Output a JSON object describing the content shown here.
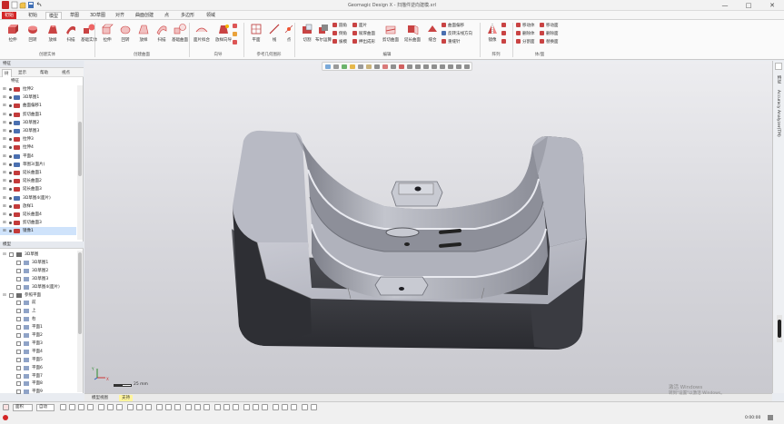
{
  "window": {
    "title": "Geomagic Design X - 扫描件逆向建模.xrl",
    "minimize": "—",
    "maximize": "□",
    "close": "✕"
  },
  "menu": {
    "tabs": [
      "初始",
      "初始",
      "模型",
      "草图",
      "3D草图",
      "对齐",
      "曲面创建",
      "点",
      "多边形",
      "领域"
    ]
  },
  "ribbon": {
    "create_solid": {
      "label": "创建实体",
      "buttons": [
        "拉伸",
        "回转",
        "放样",
        "扫描",
        "基础实体"
      ]
    },
    "create_surface": {
      "label": "创建曲面",
      "buttons": [
        "拉伸",
        "回转",
        "放样",
        "扫描",
        "基础曲面"
      ]
    },
    "wizard": {
      "label": "向导",
      "buttons": [
        "面片拟合",
        "放样向导"
      ]
    },
    "ref_geometry": {
      "label": "参考几何图形",
      "buttons": [
        "平面",
        "线",
        "点"
      ]
    },
    "edit": {
      "label": "编辑",
      "big_buttons": [
        "切割",
        "布尔运算",
        "剪切曲面",
        "延长曲面",
        "缝合"
      ],
      "small_items": [
        "圆角",
        "倒角",
        "拔模",
        "面片",
        "赋厚曲面",
        "押出成形",
        "曲面偏移",
        "反转法线方向",
        "重缝针"
      ]
    },
    "array": {
      "label": "阵列",
      "buttons": [
        "镜像"
      ]
    },
    "body_face": {
      "label": "体/面",
      "items": [
        "移动体",
        "删除体",
        "分割面",
        "移动面",
        "删除面",
        "替换面"
      ]
    }
  },
  "left_panel": {
    "header": "特征",
    "tabs": [
      "树",
      "显示",
      "帮助",
      "视点"
    ],
    "feature_header": "特征",
    "feature_tree": [
      {
        "label": "拉伸2",
        "color": "#c33a3a"
      },
      {
        "label": "3D草图1",
        "color": "#4a6fb0"
      },
      {
        "label": "曲面偏移1",
        "color": "#c33a3a"
      },
      {
        "label": "剪切曲面1",
        "color": "#c33a3a"
      },
      {
        "label": "3D草图2",
        "color": "#4a6fb0"
      },
      {
        "label": "3D草图3",
        "color": "#4a6fb0"
      },
      {
        "label": "拉伸3",
        "color": "#c33a3a"
      },
      {
        "label": "拉伸4",
        "color": "#c33a3a"
      },
      {
        "label": "平面4",
        "color": "#4a6fb0"
      },
      {
        "label": "草图3(面片)",
        "color": "#4a6fb0"
      },
      {
        "label": "延长曲面1",
        "color": "#c33a3a"
      },
      {
        "label": "延长曲面2",
        "color": "#c33a3a"
      },
      {
        "label": "延长曲面3",
        "color": "#c33a3a"
      },
      {
        "label": "3D草图4(面片)",
        "color": "#4a6fb0"
      },
      {
        "label": "放样1",
        "color": "#c33a3a"
      },
      {
        "label": "延长曲面4",
        "color": "#c33a3a"
      },
      {
        "label": "剪切曲面3",
        "color": "#c33a3a"
      },
      {
        "label": "镜像1",
        "color": "#c33a3a"
      }
    ],
    "model_header": "模型",
    "model_tree": [
      {
        "label": "3D草图",
        "level": 0
      },
      {
        "label": "3D草图1",
        "level": 1
      },
      {
        "label": "3D草图2",
        "level": 1
      },
      {
        "label": "3D草图3",
        "level": 1
      },
      {
        "label": "3D草图4(面片)",
        "level": 1
      },
      {
        "label": "参照平面",
        "level": 0
      },
      {
        "label": "前",
        "level": 1
      },
      {
        "label": "上",
        "level": 1
      },
      {
        "label": "右",
        "level": 1
      },
      {
        "label": "平面1",
        "level": 1
      },
      {
        "label": "平面2",
        "level": 1
      },
      {
        "label": "平面3",
        "level": 1
      },
      {
        "label": "平面4",
        "level": 1
      },
      {
        "label": "平面5",
        "level": 1
      },
      {
        "label": "平面6",
        "level": 1
      },
      {
        "label": "平面7",
        "level": 1
      },
      {
        "label": "平面8",
        "level": 1
      },
      {
        "label": "平面9",
        "level": 1
      }
    ]
  },
  "viewport": {
    "scale_label": "25 mm",
    "triad": {
      "x": "X",
      "y": "Y"
    }
  },
  "right_strip": {
    "tabs": [
      "特征",
      "Accuracy Analyzer(TM)"
    ]
  },
  "view_tabs": [
    "模型视图",
    "支持"
  ],
  "status_bar": {
    "select_mode": "面积",
    "filter": "自动",
    "time": "0:00:00"
  },
  "watermark": {
    "line1": "激活 Windows",
    "line2": "转到\"设置\"以激活 Windows。"
  },
  "colors": {
    "brand_red": "#d32626",
    "selection": "#cfe3fb",
    "model_gray": "#9a9ca6"
  }
}
